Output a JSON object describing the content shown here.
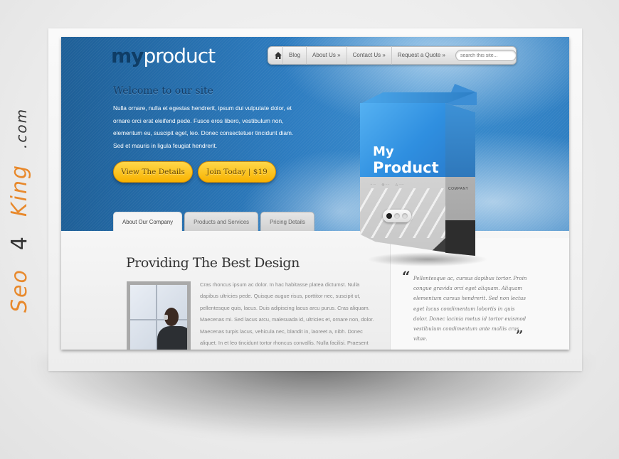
{
  "watermark": {
    "part1": "Seo",
    "part2": "4",
    "part3": "King",
    "part4": ".com"
  },
  "site": {
    "logo": {
      "my": "my",
      "product": "product"
    },
    "nav": {
      "home_icon": "home-icon",
      "items": [
        {
          "label": "Blog"
        },
        {
          "label": "About Us »"
        },
        {
          "label": "Contact Us »"
        },
        {
          "label": "Request a Quote »"
        }
      ],
      "search_placeholder": "search this site..."
    },
    "welcome": {
      "title": "Welcome to our site",
      "text": "Nulla ornare, nulla et egestas hendrerit, ipsum dui vulputate dolor, et ornare orci erat eleifend pede. Fusce eros libero, vestibulum non, elementum eu, suscipit eget, leo. Donec consectetuer tincidunt diam. Sed et mauris in ligula feugiat hendrerit."
    },
    "buttons": {
      "details": "View The Details",
      "join": "Join Today | $19"
    },
    "product_box": {
      "title_line1": "My",
      "title_line2": "Product",
      "company": "COMPANY",
      "slider_active_index": 0,
      "slider_count": 3
    },
    "tabs": [
      {
        "label": "About Our Company",
        "active": true
      },
      {
        "label": "Products and Services",
        "active": false
      },
      {
        "label": "Pricing Details",
        "active": false
      }
    ],
    "content": {
      "title": "Providing The Best Design",
      "body": "Cras rhoncus ipsum ac dolor. In hac habitasse platea dictumst. Nulla dapibus ultricies pede. Quisque augue risus, porttitor nec, suscipit ut, pellentesque quis, lacus. Duis adipiscing lacus arcu purus. Cras aliquam. Maecenas mi. Sed lacus arcu, malesuada id, ultricies et, ornare non, dolor. Maecenas turpis lacus, vehicula nec, blandit in, laoreet a, nibh. Donec aliquet. In et leo tincidunt tortor rhoncus convallis. Nulla facilisi. Praesent"
    },
    "testimonial": {
      "open_mark": "“",
      "text": "Pellentesque ac, cursus dapibus tortor. Proin congue gravida orci eget aliquam. Aliquam elementum cursus hendrerit. Sed non lectus eget lacus condimentum lobortis in quis dolor. Donec lacinia metus id tortor euismod vestibulum condimentum ante mollis cras vitae.",
      "close_mark": "”"
    }
  }
}
